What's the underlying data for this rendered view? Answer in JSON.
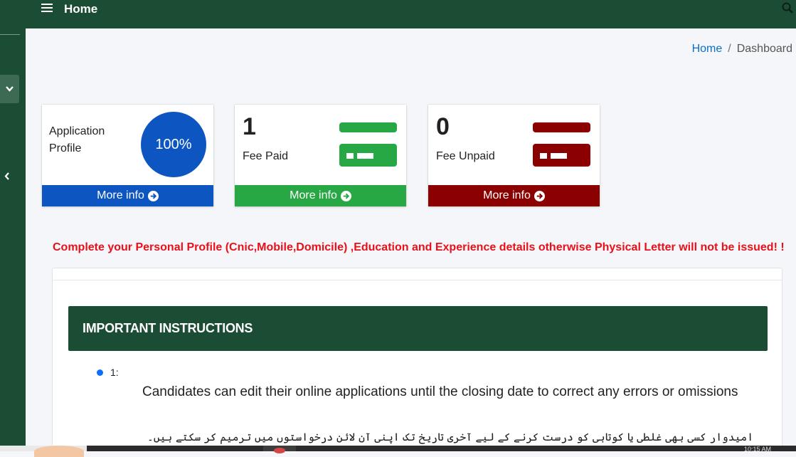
{
  "topbar": {
    "title": "Home",
    "menu_icon": "hamburger-icon",
    "search_icon": "search-icon"
  },
  "breadcrumb": {
    "home": "Home",
    "separator": "/",
    "current": "Dashboard"
  },
  "cards": [
    {
      "label": "Application Profile",
      "value": "100%",
      "progress": 1.0,
      "footer": "More info",
      "color": "#0d56c2"
    },
    {
      "value": "1",
      "label": "Fee Paid",
      "footer": "More info",
      "color": "#28a745",
      "icon": "credit-card-icon"
    },
    {
      "value": "0",
      "label": "Fee Unpaid",
      "footer": "More info",
      "color": "#8b0000",
      "icon": "credit-card-icon"
    }
  ],
  "notice": "Complete your Personal Profile (Cnic,Mobile,Domicile) ,Education and Experience details otherwise Physical Letter will not be issued! !",
  "instructions": {
    "heading": "IMPORTANT INSTRUCTIONS",
    "items": [
      {
        "number": "1:",
        "text_en": "Candidates can edit their online applications until the closing date to correct any errors or omissions",
        "text_ur": "امیدوار کسی بھی غلطی یا کوتاہی کو درست کرنے کے لیے آخری تاریخ تک اپنی آن لائن درخواستوں میں ترمیم کر سکتے ہیں۔"
      }
    ]
  },
  "taskbar": {
    "clock": "10:15 AM"
  },
  "colors": {
    "brand": "#1b4d34",
    "accent_blue": "#0d56c2",
    "success": "#28a745",
    "danger": "#8b0000",
    "notice": "#e8101a"
  }
}
